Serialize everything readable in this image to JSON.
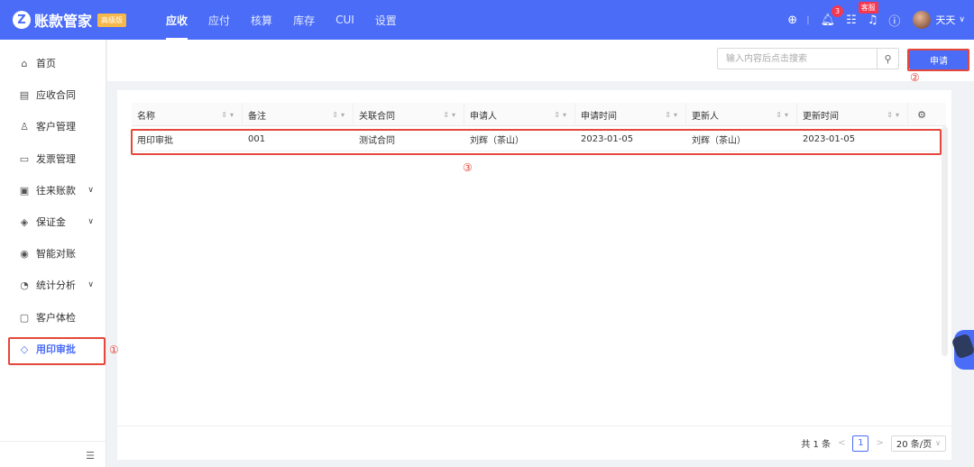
{
  "app": {
    "logo_letter": "Z",
    "name": "账款管家",
    "edition_badge": "高级版",
    "brand_color": "#4a6cf7"
  },
  "nav": {
    "items": [
      {
        "label": "应收",
        "active": true
      },
      {
        "label": "应付"
      },
      {
        "label": "核算"
      },
      {
        "label": "库存"
      },
      {
        "label": "CUI"
      },
      {
        "label": "设置"
      }
    ]
  },
  "topbar": {
    "notification_count": "3",
    "customer_service_badge": "客服",
    "user_name": "天天",
    "icons": [
      "plus-circle-icon",
      "bell-icon",
      "apps-grid-icon",
      "headset-icon",
      "help-icon",
      "chevron-down-icon"
    ]
  },
  "sidebar": {
    "items": [
      {
        "label": "首页",
        "icon": "home-icon"
      },
      {
        "label": "应收合同",
        "icon": "contract-icon"
      },
      {
        "label": "客户管理",
        "icon": "user-icon"
      },
      {
        "label": "发票管理",
        "icon": "invoice-icon"
      },
      {
        "label": "往来账款",
        "icon": "wallet-icon",
        "expandable": true
      },
      {
        "label": "保证金",
        "icon": "diamond-icon",
        "expandable": true
      },
      {
        "label": "智能对账",
        "icon": "reconcile-icon"
      },
      {
        "label": "统计分析",
        "icon": "pie-chart-icon",
        "expandable": true
      },
      {
        "label": "客户体检",
        "icon": "monitor-icon"
      },
      {
        "label": "用印审批",
        "icon": "tag-icon",
        "active": true
      }
    ]
  },
  "toolbar": {
    "search_placeholder": "输入内容后点击搜索",
    "apply_label": "申请"
  },
  "table": {
    "columns": [
      "名称",
      "备注",
      "关联合同",
      "申请人",
      "申请时间",
      "更新人",
      "更新时间"
    ],
    "rows": [
      [
        "用印审批",
        "001",
        "测试合同",
        "刘辉（茶山）",
        "2023-01-05",
        "刘辉（茶山）",
        "2023-01-05"
      ]
    ]
  },
  "pagination": {
    "total_text": "共 1 条",
    "current_page": "1",
    "page_size": "20 条/页"
  },
  "annotations": {
    "mark_1": "①",
    "mark_2": "②",
    "mark_3": "③",
    "color": "#e4473b"
  }
}
